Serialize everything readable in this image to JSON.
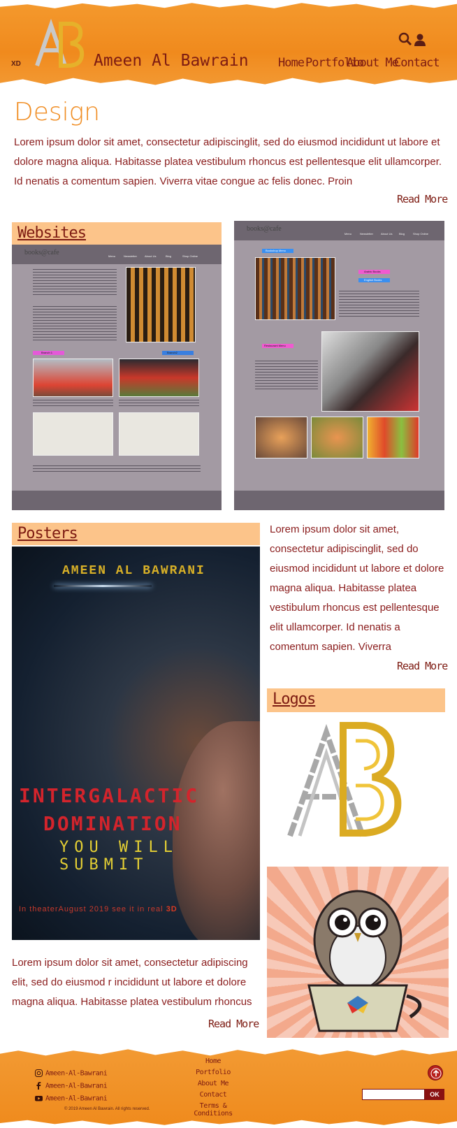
{
  "header": {
    "xd_label": "XD",
    "logo_letters": "AB",
    "site_title": "Ameen Al Bawrain",
    "nav": [
      "Home",
      "Portfolio",
      "About Me",
      "Contact"
    ],
    "icons": [
      "search-icon",
      "user-icon"
    ]
  },
  "design": {
    "title": "Design",
    "text": "Lorem ipsum dolor sit amet, consectetur adipiscinglit, sed do eiusmod incididunt ut labore et dolore magna aliqua. Habitasse platea vestibulum rhoncus est pellentesque elit ullamcorper. Id nenatis a comentum sapien. Viverra vitae congue ac felis donec. Proin",
    "read_more": "Read More"
  },
  "websites": {
    "title": "Websites",
    "mock1": {
      "logo": "books@cafe",
      "nav": [
        "Menu",
        "Newsletter",
        "About Us",
        "Blog",
        "Shop Online"
      ],
      "branch1": "Branch 1",
      "branch2": "Branch2"
    },
    "mock2": {
      "logo": "books@cafe",
      "nav": [
        "Menu",
        "Newsletter",
        "About Us",
        "Blog",
        "Shop Online"
      ],
      "bookshop": "Bookshop Menu",
      "arabic": "Arabic Books",
      "english": "English Books",
      "restaurant": "Restaurant Menu"
    }
  },
  "posters": {
    "title": "Posters",
    "poster_name": "AMEEN AL BAWRANI",
    "poster_line1": "INTERGALACTIC",
    "poster_line2": "DOMINATION",
    "poster_line3": "YOU WILL SUBMIT",
    "poster_line4": "In theaterAugust 2019 see it in real",
    "poster_3d": "3D",
    "text": "Lorem ipsum dolor sit amet, consectetur adipiscing elit, sed do eiusmod r incididunt ut labore et dolore magna aliqua. Habitasse platea vestibulum rhoncus",
    "read_more": "Read More"
  },
  "side": {
    "text": "Lorem ipsum dolor sit amet, consectetur adipiscinglit, sed do eiusmod incididunt ut labore et dolore magna aliqua. Habitasse platea vestibulum rhoncus est pellentesque elit ullamcorper. Id nenatis a comentum sapien. Viverra",
    "read_more": "Read More"
  },
  "logos": {
    "title": "Logos"
  },
  "footer": {
    "social": [
      "Ameen-Al-Bawrani",
      "Ameen-Al-Bawrani",
      "Ameen-Al-Bawrani"
    ],
    "social_icons": [
      "instagram-icon",
      "facebook-icon",
      "youtube-icon"
    ],
    "copyright": "© 2019 Ameen Al Bawrain. All rights reserved.",
    "nav": [
      "Home",
      "Portfolio",
      "About Me",
      "Contact",
      "Terms & Conditions"
    ],
    "ok": "OK",
    "input_value": ""
  },
  "colors": {
    "orange": "#f08a1d",
    "peach": "#fcc48a",
    "maroon": "#8a1c1c"
  }
}
